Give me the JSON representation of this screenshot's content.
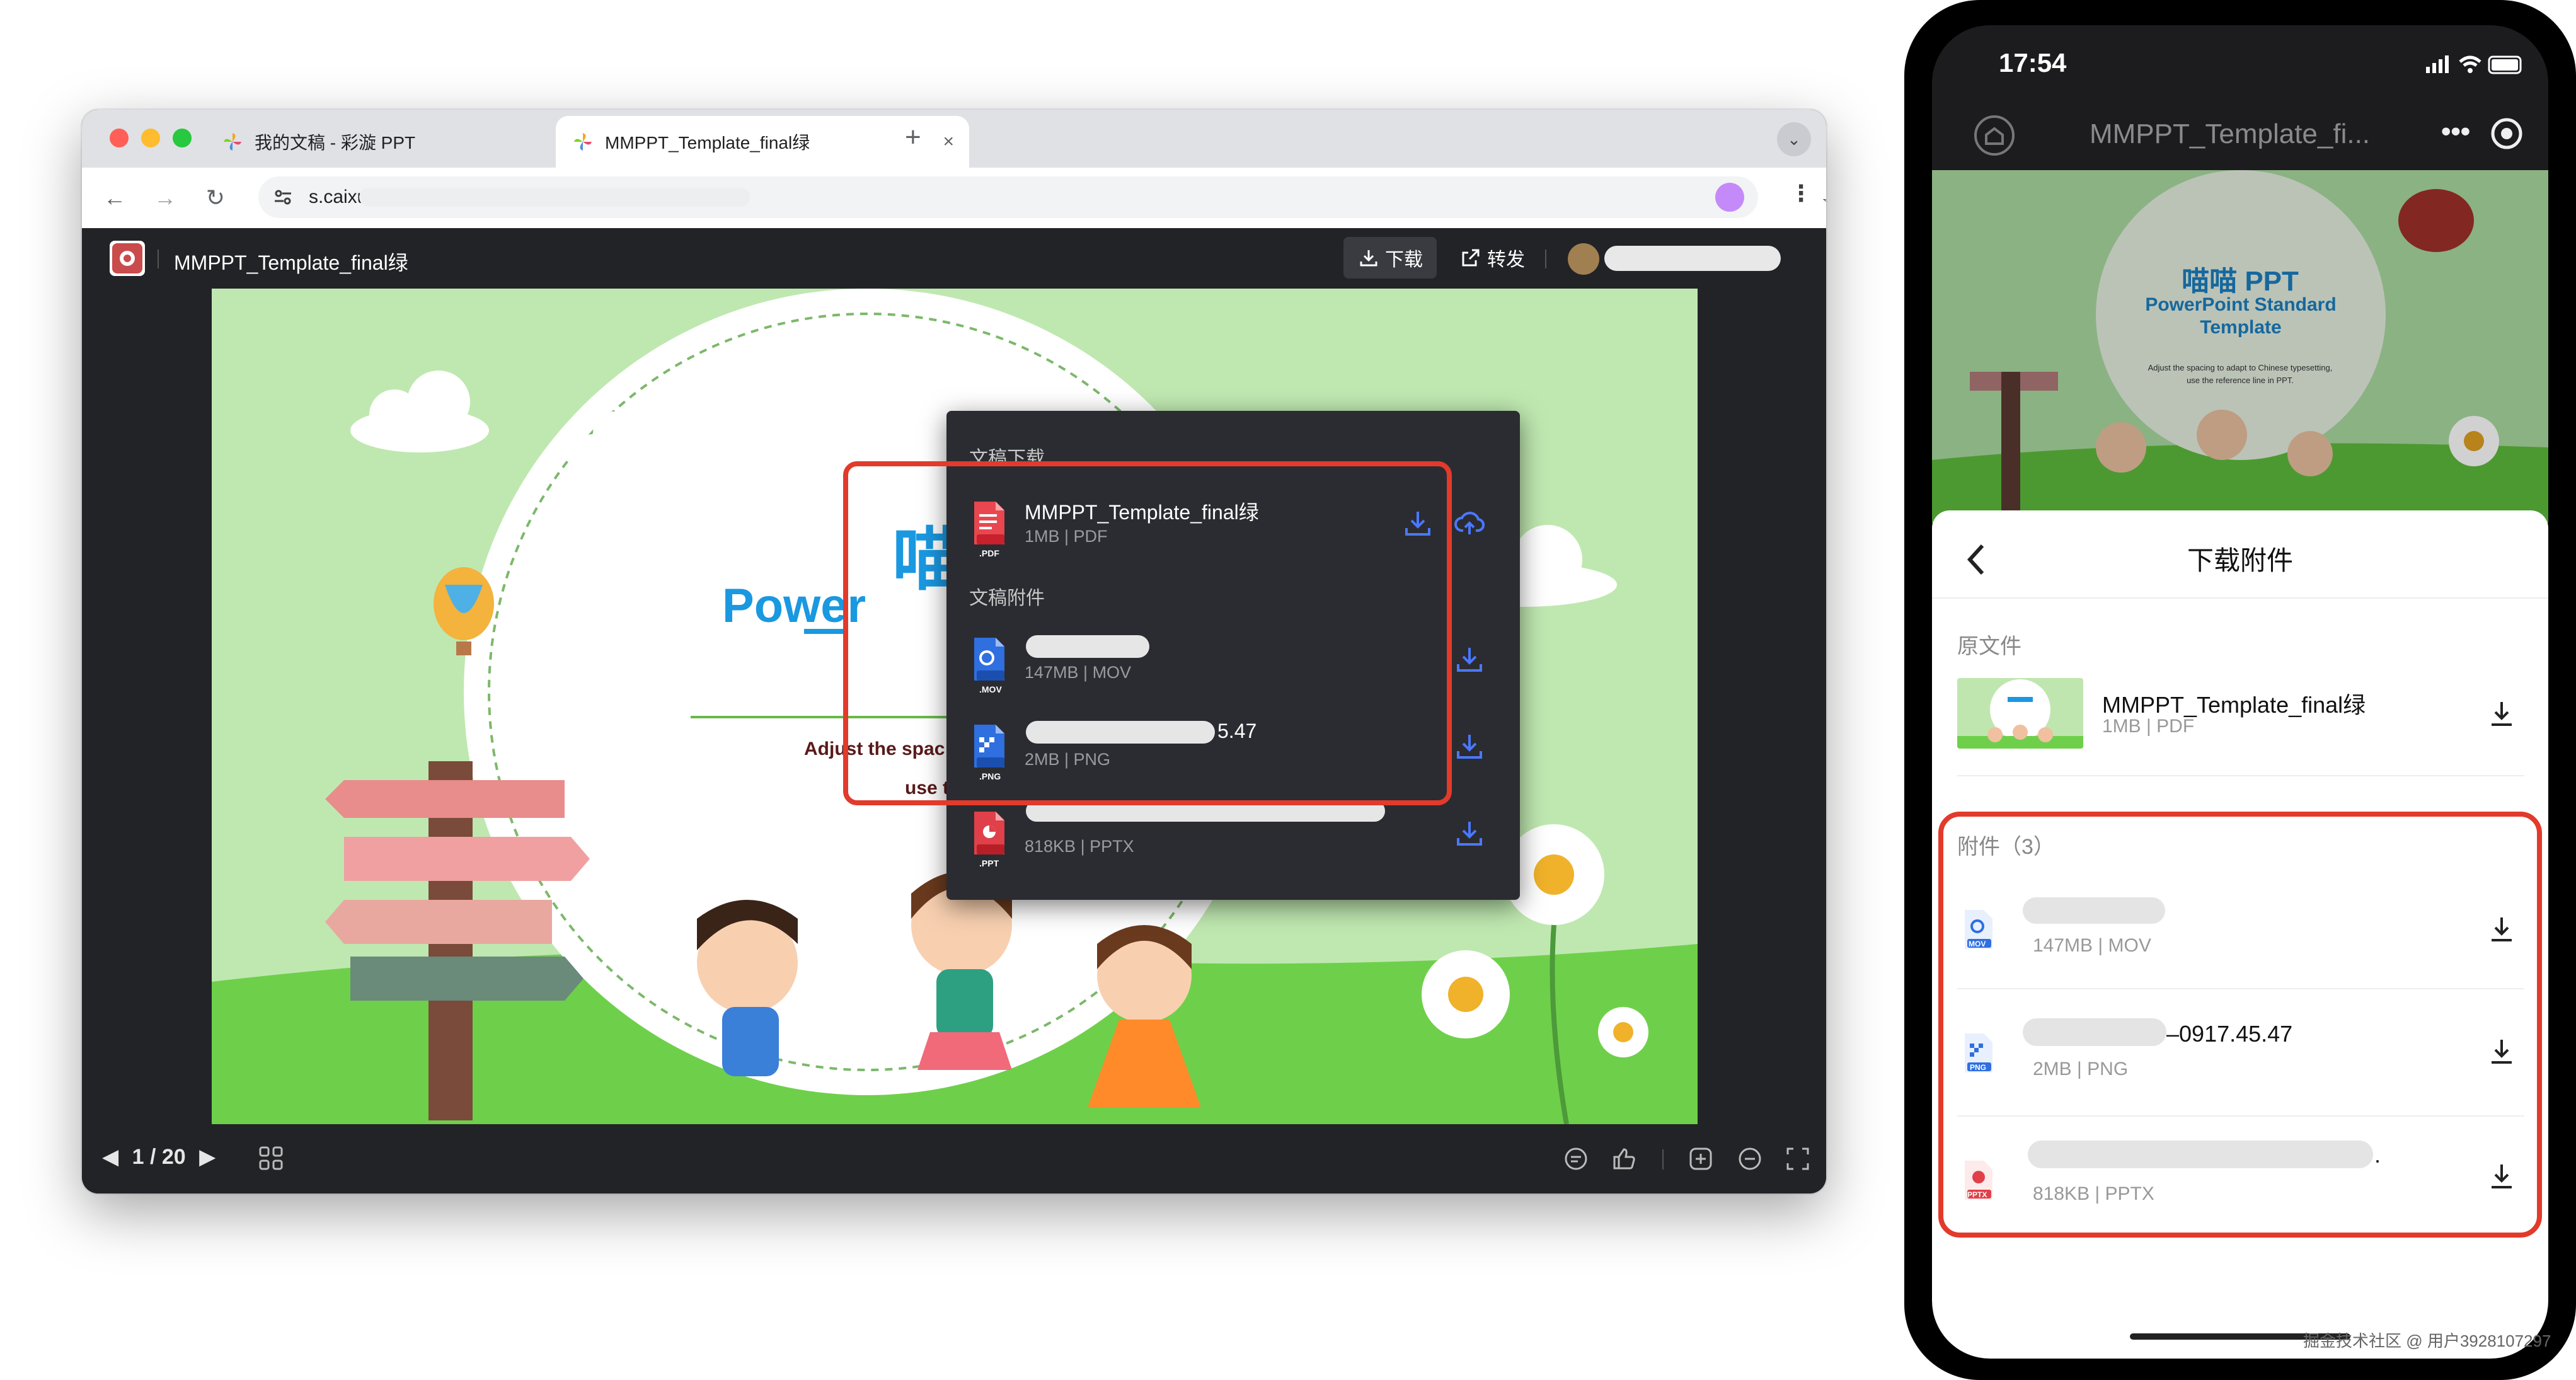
{
  "browser": {
    "tabs": [
      {
        "title": "我的文稿 - 彩漩 PPT",
        "close": "×"
      },
      {
        "title": "MMPPT_Template_final绿",
        "close": "×"
      }
    ],
    "new_tab": "+",
    "url": "s.caixu",
    "icons": [
      "back-arrow-icon",
      "forward-arrow-icon",
      "reload-icon",
      "tune-icon",
      "star-icon",
      "extension-icon",
      "kebab-menu-icon",
      "chevron-down-icon"
    ]
  },
  "doc_header": {
    "title": "MMPPT_Template_final绿",
    "download_label": "下载",
    "forward_label": "转发"
  },
  "slide": {
    "title_cn": "喵",
    "title_en": "Power",
    "subtitle_line1": "Adjust the spac",
    "subtitle_line2": "use the reference line in PPT."
  },
  "dropdown": {
    "doc_section": "文稿下载",
    "doc_file": {
      "name": "MMPPT_Template_final绿",
      "meta": "1MB | PDF",
      "badge": ".PDF"
    },
    "attach_section": "文稿附件",
    "attachments": [
      {
        "name": "",
        "meta": "147MB | MOV",
        "badge": ".MOV",
        "color": "#2f6fe0"
      },
      {
        "name": "5.47",
        "meta": "2MB | PNG",
        "badge": ".PNG",
        "color": "#2f6fe0"
      },
      {
        "name": "",
        "meta": "818KB | PPTX",
        "badge": ".PPT",
        "color": "#e0404a"
      }
    ]
  },
  "footer": {
    "page": "1 / 20"
  },
  "phone": {
    "time": "17:54",
    "nav_title": "MMPPT_Template_fi...",
    "preview": {
      "title_cn": "喵喵 PPT",
      "title_en": "PowerPoint Standard Template",
      "line1": "Adjust the spacing to adapt to Chinese typesetting,",
      "line2": "use the reference line in PPT."
    },
    "sheet_title": "下载附件",
    "original_label": "原文件",
    "original_file": {
      "name": "MMPPT_Template_final绿",
      "meta": "1MB | PDF"
    },
    "attach_label": "附件（3）",
    "attachments": [
      {
        "name": "",
        "meta": "147MB | MOV",
        "badge": "MOV",
        "color": "#2f6fe0"
      },
      {
        "name": "–0917.45.47",
        "meta": "2MB | PNG",
        "badge": "PNG",
        "color": "#2f6fe0"
      },
      {
        "name": ".",
        "meta": "818KB | PPTX",
        "badge": "PPTX",
        "color": "#e0404a"
      }
    ]
  },
  "watermark": "掘金技术社区 @ 用户3928107297",
  "colors": {
    "highlight_red": "#e23a2b",
    "accent_blue": "#4a78ff",
    "slide_green": "#bfe8b0",
    "grass": "#6ed04a"
  }
}
